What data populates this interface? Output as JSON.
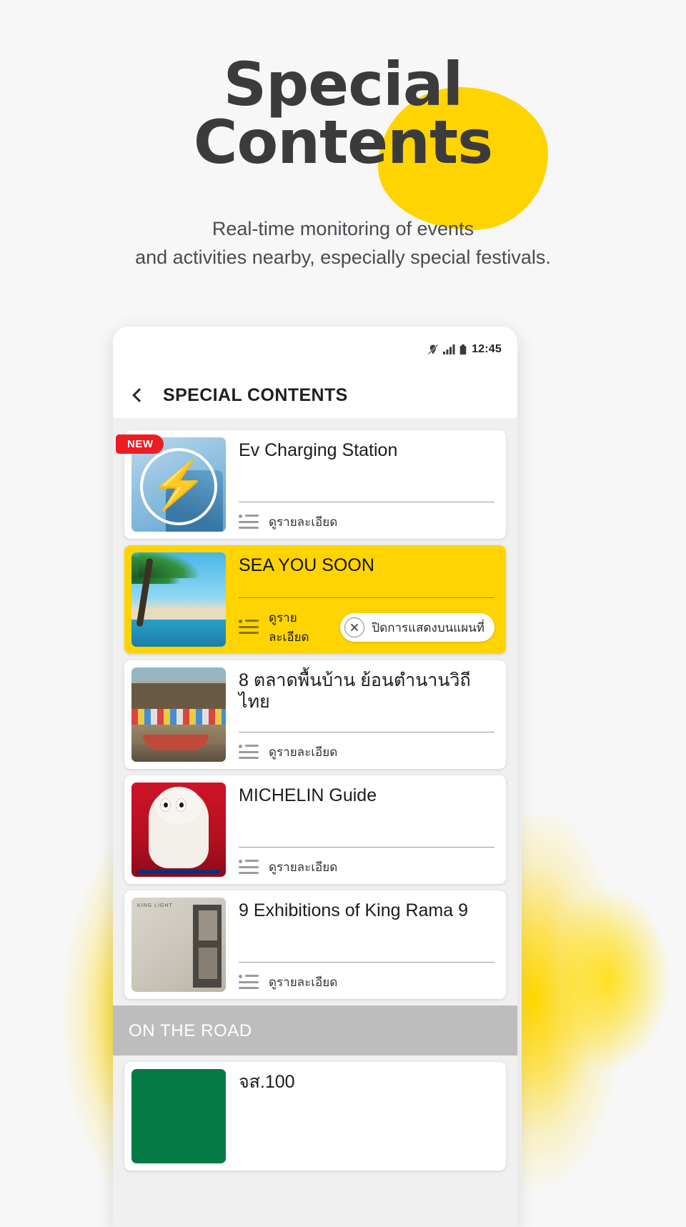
{
  "hero": {
    "title_line1": "Special",
    "title_line2": "Contents",
    "subtitle_line1": "Real-time monitoring of events",
    "subtitle_line2": "and activities nearby, especially special festivals.",
    "blob_color": "#ffd400",
    "title_color": "#3b3b3b"
  },
  "phone": {
    "statusbar": {
      "time": "12:45",
      "icons": [
        "location-off-icon",
        "signal-bars-icon",
        "battery-icon"
      ]
    },
    "appbar": {
      "back_icon": "back-chevron-icon",
      "title": "SPECIAL CONTENTS"
    },
    "cards": [
      {
        "title": "Ev Charging Station",
        "detail_label": "ดูรายละเอียด",
        "badge": "NEW",
        "highlight": false,
        "thumb": "ev-charging-thumb",
        "hide_pill": null
      },
      {
        "title": "SEA YOU SOON",
        "detail_label": "ดูรายละเอียด",
        "badge": null,
        "highlight": true,
        "thumb": "beach-thumb",
        "hide_pill": "ปิดการแสดงบนแผนที่"
      },
      {
        "title": "8 ตลาดพื้นบ้าน ย้อนตำนานวิถีไทย",
        "detail_label": "ดูรายละเอียด",
        "badge": null,
        "highlight": false,
        "thumb": "floating-market-thumb",
        "hide_pill": null
      },
      {
        "title": "MICHELIN Guide",
        "detail_label": "ดูรายละเอียด",
        "badge": null,
        "highlight": false,
        "thumb": "michelin-thumb",
        "hide_pill": null
      },
      {
        "title": "9 Exhibitions of King Rama 9",
        "detail_label": "ดูรายละเอียด",
        "badge": null,
        "highlight": false,
        "thumb": "exhibition-thumb",
        "hide_pill": null
      }
    ],
    "section": {
      "label": "ON THE ROAD"
    },
    "road_cards": [
      {
        "title": "จส.100",
        "thumb": "js100-thumb"
      }
    ]
  },
  "colors": {
    "accent_yellow": "#ffd400",
    "badge_red": "#ec1c24",
    "section_grey": "#bdbdbd",
    "page_bg": "#f7f7f7"
  }
}
